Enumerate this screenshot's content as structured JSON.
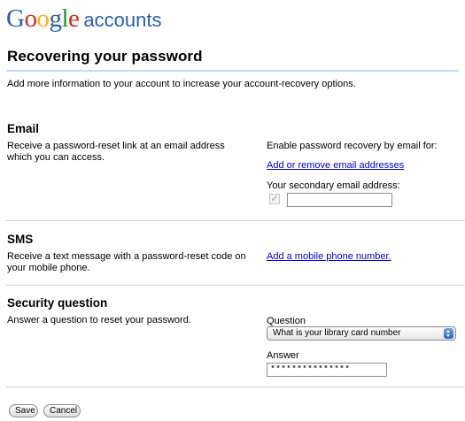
{
  "header": {
    "logo_google": "Google",
    "logo_accounts": "accounts",
    "logo_colors": [
      "#2a5db0",
      "#d42a1c",
      "#f2b50f",
      "#2a5db0",
      "#199c2f",
      "#d42a1c"
    ]
  },
  "page": {
    "title": "Recovering your password",
    "intro": "Add more information to your account to increase your account-recovery options."
  },
  "email": {
    "heading": "Email",
    "description": "Receive a password-reset link at an email address which you can access.",
    "enable_text": "Enable password recovery by email for:",
    "add_link": "Add or remove email addresses",
    "secondary_label": "Your secondary email address:",
    "checkbox_checked": true,
    "secondary_value": ""
  },
  "sms": {
    "heading": "SMS",
    "description": "Receive a text message with a password-reset code on your mobile phone.",
    "add_link": "Add a mobile phone number."
  },
  "security": {
    "heading": "Security question",
    "description": "Answer a question to reset your password.",
    "question_label": "Question",
    "question_selected": "What is your library card number",
    "answer_label": "Answer",
    "answer_value": "***************"
  },
  "buttons": {
    "save": "Save",
    "cancel": "Cancel"
  }
}
